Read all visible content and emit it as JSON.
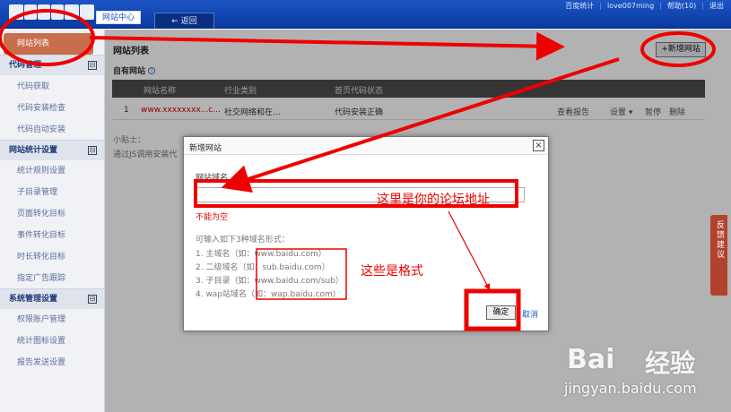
{
  "topbar": {
    "site_center": "网站中心",
    "back": "← 返回",
    "links": [
      "百度统计",
      "love007ming",
      "帮助(10)",
      "退出"
    ]
  },
  "sidebar": {
    "active": "网站列表",
    "groups": [
      {
        "title": "代码管理",
        "items": [
          "代码获取",
          "代码安装检查",
          "代码自动安装"
        ]
      },
      {
        "title": "网站统计设置",
        "items": [
          "统计规则设置",
          "子目录管理",
          "页面转化目标",
          "事件转化目标",
          "时长转化目标",
          "指定广告跟踪"
        ]
      },
      {
        "title": "系统管理设置",
        "items": [
          "权限账户管理",
          "统计图标设置",
          "报告发送设置"
        ]
      }
    ],
    "toggle_symbol": "⊟"
  },
  "main": {
    "title": "网站列表",
    "subtitle": "自有网站",
    "add_button": "+新增网站",
    "table": {
      "headers": [
        "网站名称",
        "行业类别",
        "首页代码状态"
      ],
      "rows": [
        {
          "index": "1",
          "name": "www.xxxxxxxx...c...",
          "industry": "社交网络和在...",
          "status": "代码安装正确",
          "actions": [
            "查看报告",
            "设置 ▾",
            "暂停",
            "删除"
          ]
        }
      ]
    },
    "tip_title": "小贴士：",
    "tip_text": "通过JS调用安装代"
  },
  "modal": {
    "title": "新增网站",
    "close": "×",
    "domain_label": "网站域名",
    "domain_value": "",
    "error": "不能为空",
    "formats_intro": "可输入如下3种域名形式：",
    "formats": [
      "1. 主域名（如：www.baidu.com）",
      "2. 二级域名（如：sub.baidu.com）",
      "3. 子目录（如：www.baidu.com/sub）",
      "4. wap站域名（如：wap.baidu.com)"
    ],
    "ok": "确定",
    "cancel": "取消"
  },
  "feedback": "反馈建议",
  "annotations": {
    "forum_address": "这里是你的论坛地址",
    "formats_note": "这些是格式",
    "color": "#e00000"
  },
  "watermark": {
    "brand": "Bai",
    "brand2": "经验",
    "url": "jingyan.baidu.com"
  }
}
